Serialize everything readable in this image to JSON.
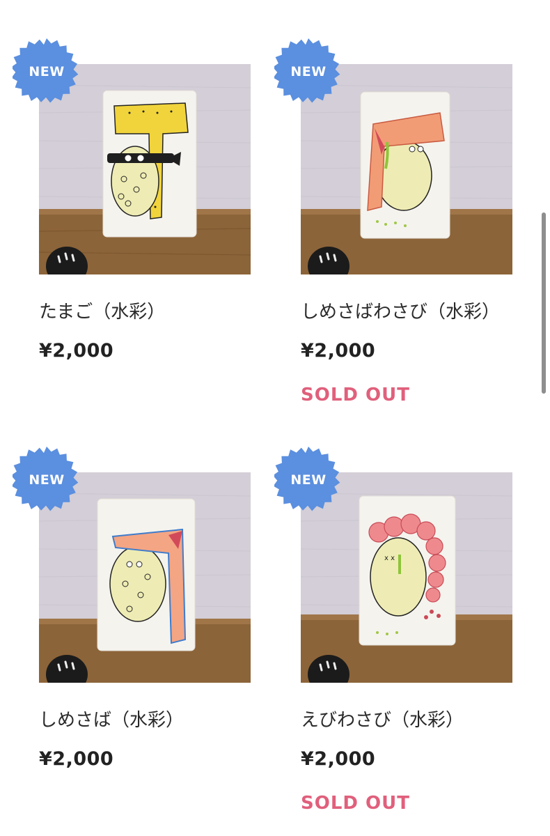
{
  "colors": {
    "badge": "#5b8fdf",
    "sold_out": "#e0607c",
    "wall": "#d2cdd5",
    "shelf": "#8a6238"
  },
  "badge_label": "NEW",
  "products": [
    {
      "title": "たまご（水彩）",
      "price": "¥2,000",
      "sold_out": "",
      "illustration": "tamago-sushi-monster"
    },
    {
      "title": "しめさばわさび（水彩）",
      "price": "¥2,000",
      "sold_out": "SOLD OUT",
      "illustration": "salmon-wasabi-sushi-monster"
    },
    {
      "title": "しめさば（水彩）",
      "price": "¥2,000",
      "sold_out": "",
      "illustration": "shimesaba-sushi-monster"
    },
    {
      "title": "えびわさび（水彩）",
      "price": "¥2,000",
      "sold_out": "SOLD OUT",
      "illustration": "shrimp-wasabi-sushi-monster"
    }
  ]
}
